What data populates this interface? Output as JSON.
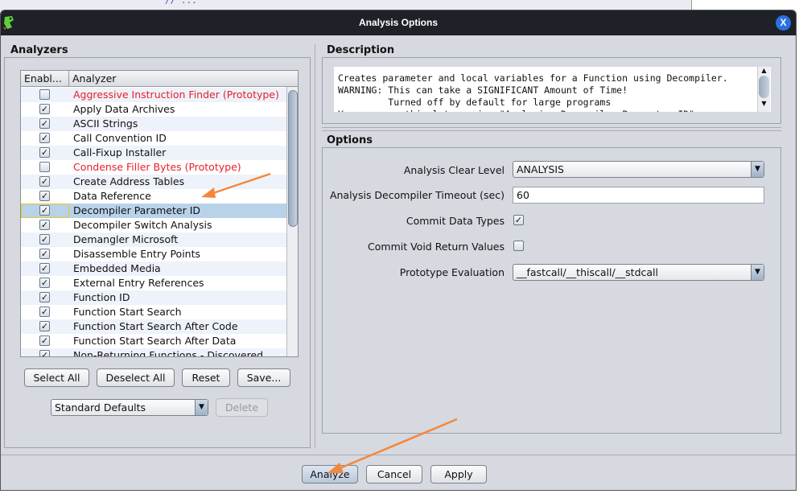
{
  "background_window": {
    "code_fragment": "//  ..."
  },
  "dialog": {
    "title": "Analysis Options",
    "close_label": "X"
  },
  "analyzers": {
    "title": "Analyzers",
    "columns": [
      "Enabl...",
      "Analyzer"
    ],
    "items": [
      {
        "label": "Aggressive Instruction Finder (Prototype)",
        "enabled": false,
        "prototype": true
      },
      {
        "label": "Apply Data Archives",
        "enabled": true
      },
      {
        "label": "ASCII Strings",
        "enabled": true
      },
      {
        "label": "Call Convention ID",
        "enabled": true
      },
      {
        "label": "Call-Fixup Installer",
        "enabled": true
      },
      {
        "label": "Condense Filler Bytes (Prototype)",
        "enabled": false,
        "prototype": true
      },
      {
        "label": "Create Address Tables",
        "enabled": true
      },
      {
        "label": "Data Reference",
        "enabled": true
      },
      {
        "label": "Decompiler Parameter ID",
        "enabled": true,
        "selected": true
      },
      {
        "label": "Decompiler Switch Analysis",
        "enabled": true
      },
      {
        "label": "Demangler Microsoft",
        "enabled": true
      },
      {
        "label": "Disassemble Entry Points",
        "enabled": true
      },
      {
        "label": "Embedded Media",
        "enabled": true
      },
      {
        "label": "External Entry References",
        "enabled": true
      },
      {
        "label": "Function ID",
        "enabled": true
      },
      {
        "label": "Function Start Search",
        "enabled": true
      },
      {
        "label": "Function Start Search After Code",
        "enabled": true
      },
      {
        "label": "Function Start Search After Data",
        "enabled": true
      },
      {
        "label": "Non-Returning Functions - Discovered",
        "enabled": true
      }
    ],
    "buttons": {
      "select_all": "Select All",
      "deselect_all": "Deselect All",
      "reset": "Reset",
      "save": "Save..."
    },
    "profile": {
      "selected": "Standard Defaults",
      "delete": "Delete"
    }
  },
  "description": {
    "title": "Description",
    "text": "Creates parameter and local variables for a Function using Decompiler.\nWARNING: This can take a SIGNIFICANT Amount of Time!\n         Turned off by default for large programs\nYou can run this later using \"Analysis->Decompiler Parameter ID\""
  },
  "options": {
    "title": "Options",
    "clear_level": {
      "label": "Analysis Clear Level",
      "value": "ANALYSIS"
    },
    "timeout": {
      "label": "Analysis Decompiler Timeout (sec)",
      "value": "60"
    },
    "commit_data_types": {
      "label": "Commit Data Types",
      "checked": true
    },
    "commit_void": {
      "label": "Commit Void Return Values",
      "checked": false
    },
    "prototype_eval": {
      "label": "Prototype Evaluation",
      "value": "__fastcall/__thiscall/__stdcall"
    }
  },
  "footer": {
    "analyze": "Analyze",
    "cancel": "Cancel",
    "apply": "Apply"
  },
  "colors": {
    "title_bar": "#1e2128",
    "dialog_bg": "#d6d9df",
    "selected_row": "#b8d2ea",
    "prototype_text": "#e8202a",
    "annotation_arrow": "#f5873a",
    "close_button": "#2b6fe0"
  }
}
